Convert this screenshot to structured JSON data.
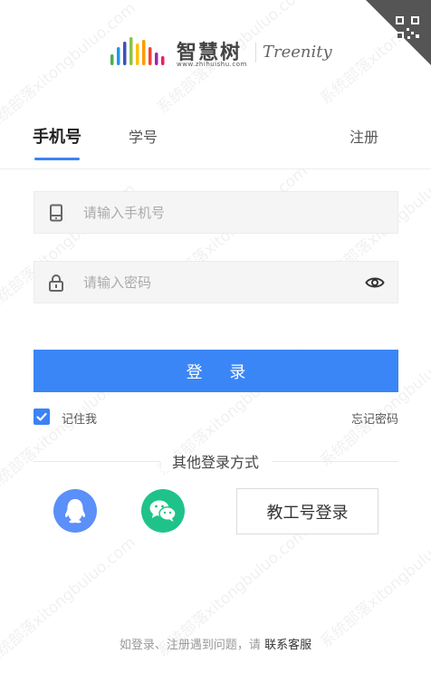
{
  "logo": {
    "cn_name": "智慧树",
    "url": "www.zhihuishu.com",
    "en_name": "Treenity"
  },
  "tabs": [
    {
      "label": "手机号",
      "active": true
    },
    {
      "label": "学号",
      "active": false
    }
  ],
  "register_label": "注册",
  "phone": {
    "placeholder": "请输入手机号",
    "value": ""
  },
  "password": {
    "placeholder": "请输入密码",
    "value": ""
  },
  "login_button": "登 录",
  "remember": {
    "label": "记住我",
    "checked": true
  },
  "forgot_password": "忘记密码",
  "other_login_title": "其他登录方式",
  "staff_login": "教工号登录",
  "footer": {
    "text": "如登录、注册遇到问题，请 ",
    "contact": "联系客服"
  },
  "watermark": "系统部落xitongbuluo.com",
  "colors": {
    "accent": "#3b86f7",
    "qq": "#5b8ff9",
    "wechat": "#1fc38a",
    "qr_corner": "#555555"
  },
  "icons": {
    "phone": "phone-icon",
    "lock": "lock-icon",
    "eye": "eye-icon",
    "check": "check-icon",
    "qq": "qq-icon",
    "wechat": "wechat-icon",
    "qr": "qr-code-icon"
  }
}
